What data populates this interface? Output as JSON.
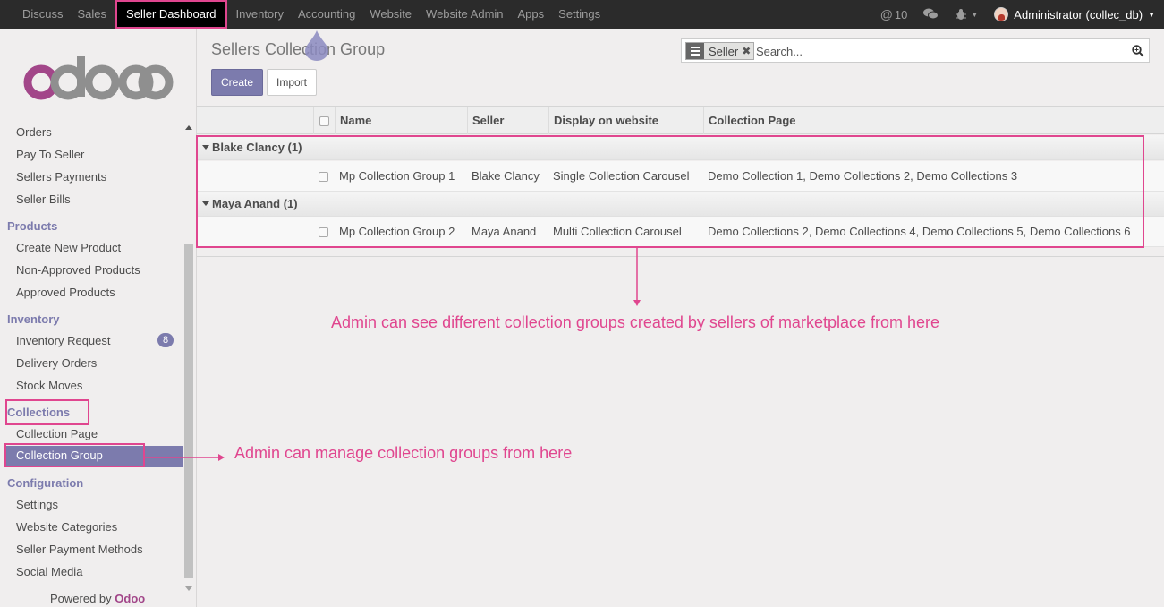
{
  "topbar": {
    "menu": [
      "Discuss",
      "Sales",
      "Seller Dashboard",
      "Inventory",
      "Accounting",
      "Website",
      "Website Admin",
      "Apps",
      "Settings"
    ],
    "active_index": 2,
    "mentions_count": "10",
    "user": "Administrator (collec_db)"
  },
  "sidebar": {
    "logo_text": "odoo",
    "items": {
      "orders": "Orders",
      "pay_to_seller": "Pay To Seller",
      "sellers_payments": "Sellers Payments",
      "seller_bills": "Seller Bills",
      "products_head": "Products",
      "create_new_product": "Create New Product",
      "non_approved_products": "Non-Approved Products",
      "approved_products": "Approved Products",
      "inventory_head": "Inventory",
      "inventory_request": "Inventory Request",
      "inventory_request_badge": "8",
      "delivery_orders": "Delivery Orders",
      "stock_moves": "Stock Moves",
      "collections_head": "Collections",
      "collection_page": "Collection Page",
      "collection_group": "Collection Group",
      "configuration_head": "Configuration",
      "settings": "Settings",
      "website_categories": "Website Categories",
      "seller_payment_methods": "Seller Payment Methods",
      "social_media": "Social Media"
    },
    "powered_by": "Powered by",
    "powered_brand": "Odoo"
  },
  "main": {
    "title": "Sellers Collection Group",
    "create_label": "Create",
    "import_label": "Import",
    "search": {
      "facet": "Seller",
      "placeholder": "Search..."
    },
    "columns": {
      "name": "Name",
      "seller": "Seller",
      "display": "Display on website",
      "page": "Collection Page"
    },
    "groups": [
      {
        "label": "Blake Clancy (1)",
        "rows": [
          {
            "name": "Mp Collection Group 1",
            "seller": "Blake Clancy",
            "display": "Single Collection Carousel",
            "page": "Demo Collection 1, Demo Collections 2, Demo Collections 3"
          }
        ]
      },
      {
        "label": "Maya Anand (1)",
        "rows": [
          {
            "name": "Mp Collection Group 2",
            "seller": "Maya Anand",
            "display": "Multi Collection Carousel",
            "page": "Demo Collections 2, Demo Collections 4, Demo Collections 5, Demo Collections 6"
          }
        ]
      }
    ]
  },
  "annotations": {
    "table_note": "Admin can see different collection groups created by sellers of marketplace from here",
    "menu_note": "Admin can manage collection groups from here",
    "color": "#e0468f"
  }
}
